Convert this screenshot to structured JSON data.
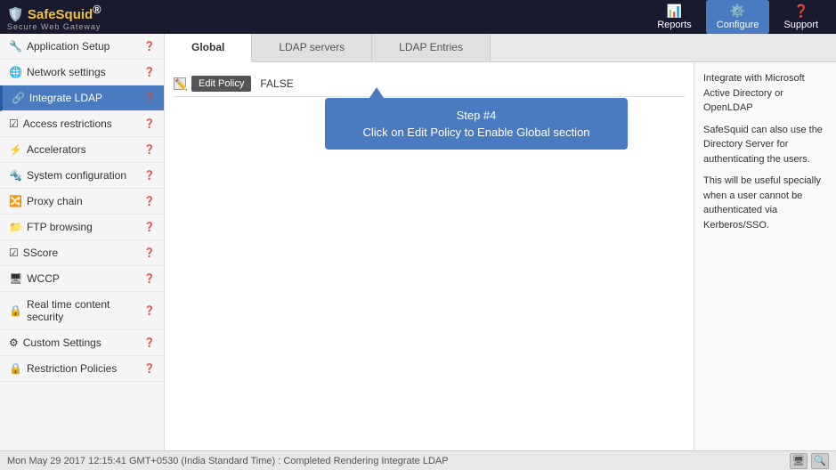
{
  "header": {
    "logo": "SafeSquid",
    "logo_reg": "®",
    "logo_sub": "Secure Web Gateway",
    "nav": [
      {
        "id": "reports",
        "label": "Reports",
        "icon": "📊"
      },
      {
        "id": "configure",
        "label": "Configure",
        "icon": "⚙️",
        "active": true
      },
      {
        "id": "support",
        "label": "Support",
        "icon": "❓"
      }
    ]
  },
  "sidebar": {
    "items": [
      {
        "id": "app-setup",
        "label": "Application Setup",
        "icon": "🔧",
        "active": false
      },
      {
        "id": "network",
        "label": "Network settings",
        "icon": "🌐",
        "active": false
      },
      {
        "id": "integrate-ldap",
        "label": "Integrate LDAP",
        "icon": "🔗",
        "active": true
      },
      {
        "id": "access",
        "label": "Access restrictions",
        "icon": "☑",
        "active": false
      },
      {
        "id": "accelerators",
        "label": "Accelerators",
        "icon": "⚡",
        "active": false
      },
      {
        "id": "sysconfig",
        "label": "System configuration",
        "icon": "🔩",
        "active": false
      },
      {
        "id": "proxy-chain",
        "label": "Proxy chain",
        "icon": "🔀",
        "active": false
      },
      {
        "id": "ftp",
        "label": "FTP browsing",
        "icon": "📁",
        "active": false
      },
      {
        "id": "sscore",
        "label": "SScore",
        "icon": "☑",
        "active": false
      },
      {
        "id": "wccp",
        "label": "WCCP",
        "icon": "🖥",
        "active": false
      },
      {
        "id": "realtime",
        "label": "Real time content security",
        "icon": "🔒",
        "active": false
      },
      {
        "id": "custom",
        "label": "Custom Settings",
        "icon": "⚙",
        "active": false
      },
      {
        "id": "restriction",
        "label": "Restriction Policies",
        "icon": "🔒",
        "active": false
      }
    ]
  },
  "tabs": [
    {
      "id": "global",
      "label": "Global",
      "active": true
    },
    {
      "id": "ldap-servers",
      "label": "LDAP servers",
      "active": false
    },
    {
      "id": "ldap-entries",
      "label": "LDAP Entries",
      "active": false
    }
  ],
  "policy_row": {
    "edit_button": "Edit Policy",
    "value": "FALSE"
  },
  "tooltip": {
    "step": "Step #4",
    "text": "Click on Edit Policy to Enable Global section"
  },
  "right_panel": {
    "paragraphs": [
      "Integrate with Microsoft Active Directory or OpenLDAP",
      "SafeSquid can also use the Directory Server for authenticating the users.",
      "This will be useful specially when a user cannot be authenticated via Kerberos/SSO."
    ]
  },
  "status_bar": {
    "text": "Mon May 29 2017 12:15:41 GMT+0530 (India Standard Time) : Completed Rendering Integrate LDAP"
  }
}
